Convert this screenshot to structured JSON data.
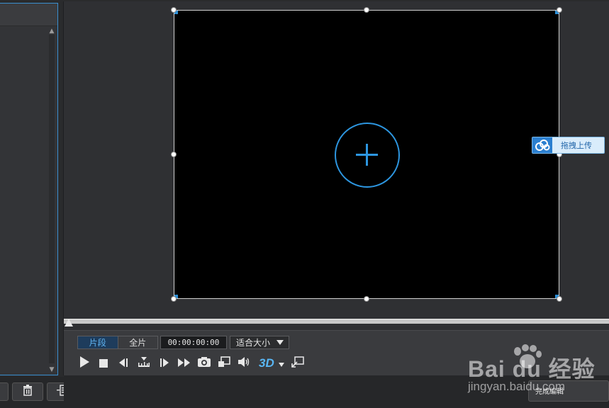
{
  "preview": {
    "upload_label": "拖拽上传"
  },
  "controls": {
    "segment_tabs": [
      {
        "label": "片段",
        "active": true
      },
      {
        "label": "全片",
        "active": false
      }
    ],
    "timecode": "00:00:00:00",
    "fit_mode": "适合大小",
    "threed_label": "3D",
    "timeline_position": 0
  },
  "bottom": {
    "right_button_label": "完成編輯"
  },
  "watermark": {
    "logo": "Bai du 经验",
    "url": "jingyan.baidu.com"
  },
  "colors": {
    "accent": "#2d96e0",
    "active_tab_bg": "#1e3c5c"
  },
  "icons": [
    "play-icon",
    "stop-icon",
    "prev-frame-icon",
    "trim-icon",
    "next-frame-icon",
    "fast-forward-icon",
    "snapshot-icon",
    "overlay-icon",
    "volume-icon",
    "3d-icon",
    "dropdown-arrow-icon",
    "resize-icon",
    "delete-icon",
    "list-add-icon",
    "cloud-upload-icon",
    "add-icon"
  ]
}
